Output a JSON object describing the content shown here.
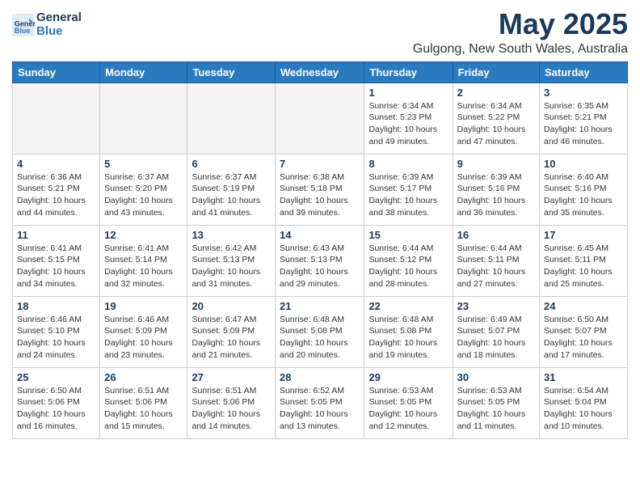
{
  "header": {
    "logo_line1": "General",
    "logo_line2": "Blue",
    "month_title": "May 2025",
    "location": "Gulgong, New South Wales, Australia"
  },
  "days_of_week": [
    "Sunday",
    "Monday",
    "Tuesday",
    "Wednesday",
    "Thursday",
    "Friday",
    "Saturday"
  ],
  "weeks": [
    [
      {
        "num": "",
        "info": ""
      },
      {
        "num": "",
        "info": ""
      },
      {
        "num": "",
        "info": ""
      },
      {
        "num": "",
        "info": ""
      },
      {
        "num": "1",
        "info": "Sunrise: 6:34 AM\nSunset: 5:23 PM\nDaylight: 10 hours\nand 49 minutes."
      },
      {
        "num": "2",
        "info": "Sunrise: 6:34 AM\nSunset: 5:22 PM\nDaylight: 10 hours\nand 47 minutes."
      },
      {
        "num": "3",
        "info": "Sunrise: 6:35 AM\nSunset: 5:21 PM\nDaylight: 10 hours\nand 46 minutes."
      }
    ],
    [
      {
        "num": "4",
        "info": "Sunrise: 6:36 AM\nSunset: 5:21 PM\nDaylight: 10 hours\nand 44 minutes."
      },
      {
        "num": "5",
        "info": "Sunrise: 6:37 AM\nSunset: 5:20 PM\nDaylight: 10 hours\nand 43 minutes."
      },
      {
        "num": "6",
        "info": "Sunrise: 6:37 AM\nSunset: 5:19 PM\nDaylight: 10 hours\nand 41 minutes."
      },
      {
        "num": "7",
        "info": "Sunrise: 6:38 AM\nSunset: 5:18 PM\nDaylight: 10 hours\nand 39 minutes."
      },
      {
        "num": "8",
        "info": "Sunrise: 6:39 AM\nSunset: 5:17 PM\nDaylight: 10 hours\nand 38 minutes."
      },
      {
        "num": "9",
        "info": "Sunrise: 6:39 AM\nSunset: 5:16 PM\nDaylight: 10 hours\nand 36 minutes."
      },
      {
        "num": "10",
        "info": "Sunrise: 6:40 AM\nSunset: 5:16 PM\nDaylight: 10 hours\nand 35 minutes."
      }
    ],
    [
      {
        "num": "11",
        "info": "Sunrise: 6:41 AM\nSunset: 5:15 PM\nDaylight: 10 hours\nand 34 minutes."
      },
      {
        "num": "12",
        "info": "Sunrise: 6:41 AM\nSunset: 5:14 PM\nDaylight: 10 hours\nand 32 minutes."
      },
      {
        "num": "13",
        "info": "Sunrise: 6:42 AM\nSunset: 5:13 PM\nDaylight: 10 hours\nand 31 minutes."
      },
      {
        "num": "14",
        "info": "Sunrise: 6:43 AM\nSunset: 5:13 PM\nDaylight: 10 hours\nand 29 minutes."
      },
      {
        "num": "15",
        "info": "Sunrise: 6:44 AM\nSunset: 5:12 PM\nDaylight: 10 hours\nand 28 minutes."
      },
      {
        "num": "16",
        "info": "Sunrise: 6:44 AM\nSunset: 5:11 PM\nDaylight: 10 hours\nand 27 minutes."
      },
      {
        "num": "17",
        "info": "Sunrise: 6:45 AM\nSunset: 5:11 PM\nDaylight: 10 hours\nand 25 minutes."
      }
    ],
    [
      {
        "num": "18",
        "info": "Sunrise: 6:46 AM\nSunset: 5:10 PM\nDaylight: 10 hours\nand 24 minutes."
      },
      {
        "num": "19",
        "info": "Sunrise: 6:46 AM\nSunset: 5:09 PM\nDaylight: 10 hours\nand 23 minutes."
      },
      {
        "num": "20",
        "info": "Sunrise: 6:47 AM\nSunset: 5:09 PM\nDaylight: 10 hours\nand 21 minutes."
      },
      {
        "num": "21",
        "info": "Sunrise: 6:48 AM\nSunset: 5:08 PM\nDaylight: 10 hours\nand 20 minutes."
      },
      {
        "num": "22",
        "info": "Sunrise: 6:48 AM\nSunset: 5:08 PM\nDaylight: 10 hours\nand 19 minutes."
      },
      {
        "num": "23",
        "info": "Sunrise: 6:49 AM\nSunset: 5:07 PM\nDaylight: 10 hours\nand 18 minutes."
      },
      {
        "num": "24",
        "info": "Sunrise: 6:50 AM\nSunset: 5:07 PM\nDaylight: 10 hours\nand 17 minutes."
      }
    ],
    [
      {
        "num": "25",
        "info": "Sunrise: 6:50 AM\nSunset: 5:06 PM\nDaylight: 10 hours\nand 16 minutes."
      },
      {
        "num": "26",
        "info": "Sunrise: 6:51 AM\nSunset: 5:06 PM\nDaylight: 10 hours\nand 15 minutes."
      },
      {
        "num": "27",
        "info": "Sunrise: 6:51 AM\nSunset: 5:06 PM\nDaylight: 10 hours\nand 14 minutes."
      },
      {
        "num": "28",
        "info": "Sunrise: 6:52 AM\nSunset: 5:05 PM\nDaylight: 10 hours\nand 13 minutes."
      },
      {
        "num": "29",
        "info": "Sunrise: 6:53 AM\nSunset: 5:05 PM\nDaylight: 10 hours\nand 12 minutes."
      },
      {
        "num": "30",
        "info": "Sunrise: 6:53 AM\nSunset: 5:05 PM\nDaylight: 10 hours\nand 11 minutes."
      },
      {
        "num": "31",
        "info": "Sunrise: 6:54 AM\nSunset: 5:04 PM\nDaylight: 10 hours\nand 10 minutes."
      }
    ]
  ]
}
